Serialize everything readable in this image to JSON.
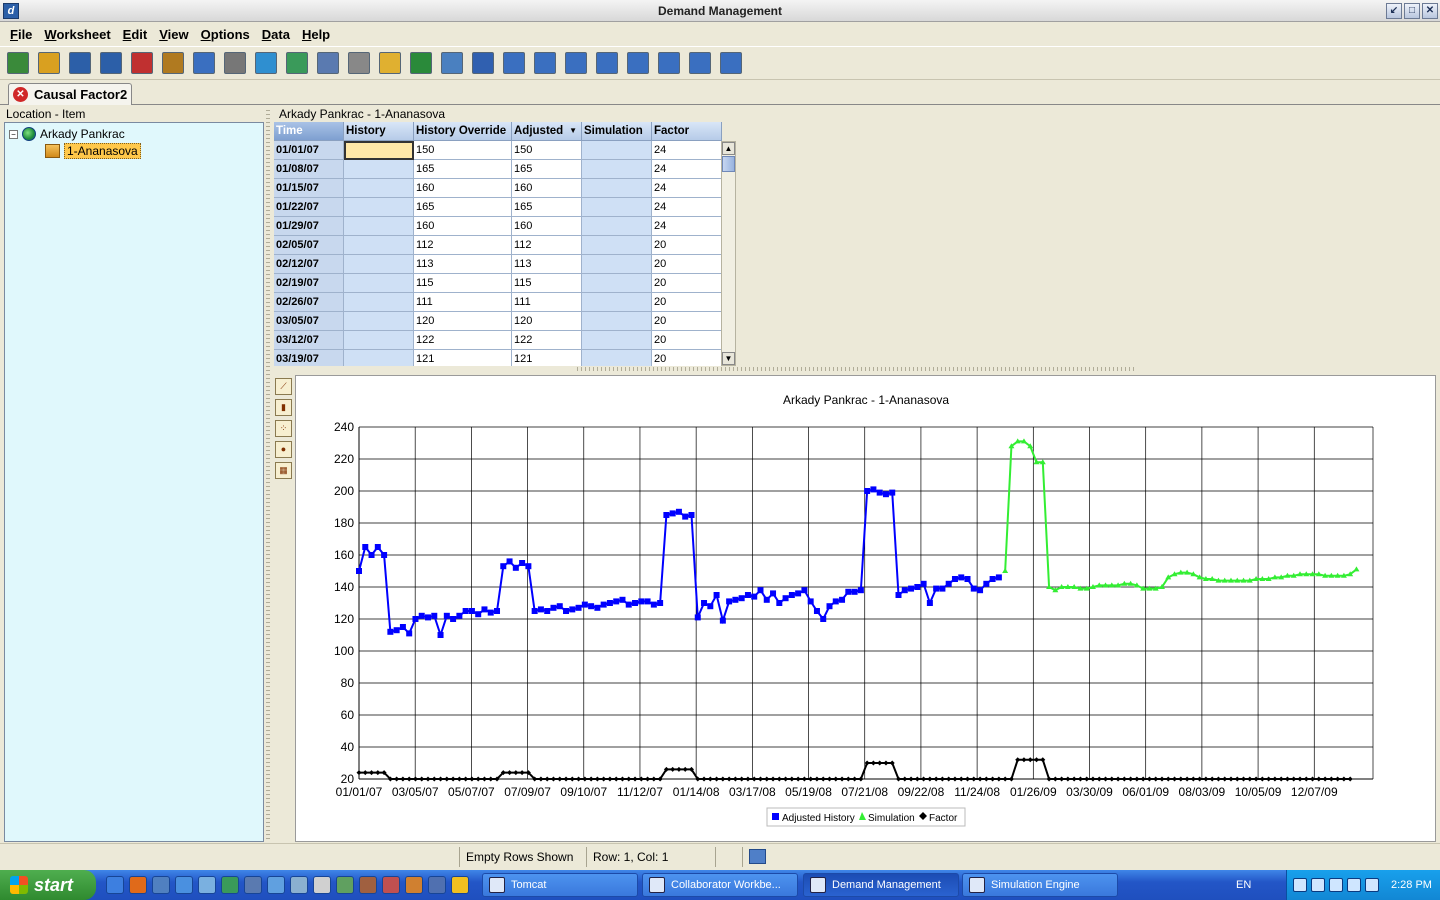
{
  "window": {
    "title": "Demand Management"
  },
  "menu": [
    "File",
    "Worksheet",
    "Edit",
    "View",
    "Options",
    "Data",
    "Help"
  ],
  "toolbar_icons": [
    "chart-icon",
    "open-icon",
    "save-icon",
    "save-all-icon",
    "close-icon",
    "settings-icon",
    "info-icon",
    "book-icon",
    "refresh-icon",
    "run-icon",
    "calculator-icon",
    "print-icon",
    "email-icon",
    "export-icon",
    "table-icon",
    "windows-icon",
    "window-icon",
    "bar-chart-icon",
    "tree-icon",
    "target-icon",
    "columns-icon",
    "wizard-icon",
    "filter-icon",
    "grid-icon"
  ],
  "tab": {
    "label": "Causal Factor2"
  },
  "tree": {
    "title": "Location - Item",
    "root": "Arkady Pankrac",
    "child": "1-Ananasova"
  },
  "grid": {
    "title": "Arkady Pankrac - 1-Ananasova",
    "columns": [
      "Time",
      "History",
      "History Override",
      "Adjusted",
      "Simulation",
      "Factor"
    ],
    "rows": [
      [
        "01/01/07",
        "",
        "150",
        "150",
        "",
        "24"
      ],
      [
        "01/08/07",
        "",
        "165",
        "165",
        "",
        "24"
      ],
      [
        "01/15/07",
        "",
        "160",
        "160",
        "",
        "24"
      ],
      [
        "01/22/07",
        "",
        "165",
        "165",
        "",
        "24"
      ],
      [
        "01/29/07",
        "",
        "160",
        "160",
        "",
        "24"
      ],
      [
        "02/05/07",
        "",
        "112",
        "112",
        "",
        "20"
      ],
      [
        "02/12/07",
        "",
        "113",
        "113",
        "",
        "20"
      ],
      [
        "02/19/07",
        "",
        "115",
        "115",
        "",
        "20"
      ],
      [
        "02/26/07",
        "",
        "111",
        "111",
        "",
        "20"
      ],
      [
        "03/05/07",
        "",
        "120",
        "120",
        "",
        "20"
      ],
      [
        "03/12/07",
        "",
        "122",
        "122",
        "",
        "20"
      ],
      [
        "03/19/07",
        "",
        "121",
        "121",
        "",
        "20"
      ]
    ]
  },
  "chart_tools": [
    "line-chart-icon",
    "bar-chart-icon",
    "scatter-chart-icon",
    "pie-chart-icon",
    "stacked-bar-icon"
  ],
  "chart_data": {
    "type": "line",
    "title": "Arkady Pankrac - 1-Ananasova",
    "xlabel": "",
    "ylabel": "",
    "ylim": [
      20,
      240
    ],
    "yticks": [
      20,
      40,
      60,
      80,
      100,
      120,
      140,
      160,
      180,
      200,
      220,
      240
    ],
    "xtick_labels": [
      "01/01/07",
      "03/05/07",
      "05/07/07",
      "07/09/07",
      "09/10/07",
      "11/12/07",
      "01/14/08",
      "03/17/08",
      "05/19/08",
      "07/21/08",
      "09/22/08",
      "11/24/08",
      "01/26/09",
      "03/30/09",
      "06/01/09",
      "08/03/09",
      "10/05/09",
      "12/07/09"
    ],
    "grid": true,
    "legend": "bottom-center",
    "series": [
      {
        "name": "Adjusted History",
        "color": "#0000ff",
        "start_index": 0,
        "values": [
          150,
          165,
          160,
          165,
          160,
          112,
          113,
          115,
          111,
          120,
          122,
          121,
          122,
          110,
          122,
          120,
          122,
          125,
          125,
          123,
          126,
          124,
          125,
          153,
          156,
          152,
          155,
          153,
          125,
          126,
          125,
          127,
          128,
          125,
          126,
          127,
          129,
          128,
          127,
          129,
          130,
          131,
          132,
          129,
          130,
          131,
          131,
          129,
          130,
          185,
          186,
          187,
          184,
          185,
          121,
          130,
          128,
          135,
          119,
          131,
          132,
          133,
          135,
          134,
          138,
          132,
          136,
          130,
          133,
          135,
          136,
          138,
          131,
          125,
          120,
          128,
          131,
          132,
          137,
          137,
          138,
          200,
          201,
          199,
          198,
          199,
          135,
          138,
          139,
          140,
          142,
          130,
          139,
          139,
          142,
          145,
          146,
          145,
          139,
          138,
          142,
          145,
          146
        ]
      },
      {
        "name": "Simulation",
        "color": "#33ee33",
        "start_index": 103,
        "values": [
          150,
          228,
          231,
          231,
          228,
          218,
          218,
          140,
          138,
          140,
          140,
          140,
          139,
          139,
          140,
          141,
          141,
          141,
          141,
          142,
          142,
          141,
          139,
          139,
          139,
          140,
          146,
          148,
          149,
          149,
          148,
          146,
          145,
          145,
          144,
          144,
          144,
          144,
          144,
          144,
          145,
          145,
          145,
          146,
          146,
          147,
          147,
          148,
          148,
          148,
          148,
          147,
          147,
          147,
          147,
          148,
          151
        ]
      },
      {
        "name": "Factor",
        "color": "#000000",
        "start_index": 0,
        "values": [
          24,
          24,
          24,
          24,
          24,
          20,
          20,
          20,
          20,
          20,
          20,
          20,
          20,
          20,
          20,
          20,
          20,
          20,
          20,
          20,
          20,
          20,
          20,
          24,
          24,
          24,
          24,
          24,
          20,
          20,
          20,
          20,
          20,
          20,
          20,
          20,
          20,
          20,
          20,
          20,
          20,
          20,
          20,
          20,
          20,
          20,
          20,
          20,
          20,
          26,
          26,
          26,
          26,
          26,
          20,
          20,
          20,
          20,
          20,
          20,
          20,
          20,
          20,
          20,
          20,
          20,
          20,
          20,
          20,
          20,
          20,
          20,
          20,
          20,
          20,
          20,
          20,
          20,
          20,
          20,
          20,
          30,
          30,
          30,
          30,
          30,
          20,
          20,
          20,
          20,
          20,
          20,
          20,
          20,
          20,
          20,
          20,
          20,
          20,
          20,
          20,
          20,
          20,
          20,
          20,
          32,
          32,
          32,
          32,
          32,
          20,
          20,
          20,
          20,
          20,
          20,
          20,
          20,
          20,
          20,
          20,
          20,
          20,
          20,
          20,
          20,
          20,
          20,
          20,
          20,
          20,
          20,
          20,
          20,
          20,
          20,
          20,
          20,
          20,
          20,
          20,
          20,
          20,
          20,
          20,
          20,
          20,
          20,
          20,
          20,
          20,
          20,
          20,
          20,
          20,
          20,
          20,
          20,
          20
        ]
      }
    ]
  },
  "status": {
    "rows_shown": "Empty Rows Shown",
    "cursor": "Row: 1, Col: 1"
  },
  "taskbar": {
    "start_label": "start",
    "quick_launch": [
      "ie-icon",
      "firefox-icon",
      "thunderbird-icon",
      "chrome-icon",
      "app-icon",
      "app-icon",
      "app-icon",
      "app-icon",
      "app-icon",
      "app-icon",
      "app-icon",
      "app-icon",
      "app-icon",
      "app-icon",
      "app-icon",
      "app-icon"
    ],
    "tasks": [
      {
        "label": "Tomcat",
        "active": false
      },
      {
        "label": "Collaborator Workbe...",
        "active": false
      },
      {
        "label": "Demand Management",
        "active": true
      },
      {
        "label": "Simulation Engine",
        "active": false
      }
    ],
    "language": "EN",
    "clock": "2:28 PM"
  }
}
